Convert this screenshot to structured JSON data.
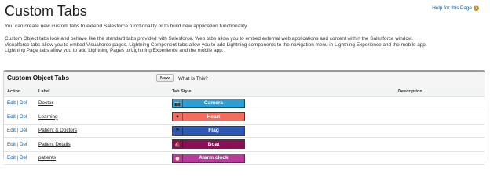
{
  "page": {
    "title": "Custom Tabs",
    "help_link": "Help for this Page",
    "intro": "You can create new custom tabs to extend Salesforce functionality or to build new application functionality.",
    "description": [
      "Custom Object tabs look and behave like the standard tabs provided with Salesforce. Web tabs allow you to embed external web applications and content within the Salesforce window.",
      "Visualforce tabs allow you to embed Visualforce pages. Lightning Component tabs allow you to add Lightning components to the navigation menu in Lightning Experience and the mobile app.",
      "Lightning Page tabs allow you to add Lightning Pages to Lightning Experience and the mobile app."
    ]
  },
  "panel": {
    "title": "Custom Object Tabs",
    "new_button": "New",
    "what_link": "What Is This?",
    "columns": [
      "Action",
      "Label",
      "Tab Style",
      "Description"
    ],
    "rows": [
      {
        "edit": "Edit",
        "sep": "|",
        "del": "Del",
        "label": "Doctor",
        "style": "Camera",
        "color": "#2a9fd6",
        "icon": "camera-icon",
        "glyph": "📷",
        "description": ""
      },
      {
        "edit": "Edit",
        "sep": "|",
        "del": "Del",
        "label": "Learning",
        "style": "Heart",
        "color": "#f26d5e",
        "icon": "heart-icon",
        "glyph": "♥",
        "description": ""
      },
      {
        "edit": "Edit",
        "sep": "|",
        "del": "Del",
        "label": "Patient & Doctors",
        "style": "Flag",
        "color": "#2e57b5",
        "icon": "flag-icon",
        "glyph": "⚑",
        "description": ""
      },
      {
        "edit": "Edit",
        "sep": "|",
        "del": "Del",
        "label": "Patient Details",
        "style": "Boat",
        "color": "#8a0f57",
        "icon": "boat-icon",
        "glyph": "⛵",
        "description": ""
      },
      {
        "edit": "Edit",
        "sep": "|",
        "del": "Del",
        "label": "patients",
        "style": "Alarm clock",
        "color": "#b83d9a",
        "icon": "alarm-clock-icon",
        "glyph": "⏰",
        "description": ""
      }
    ]
  }
}
